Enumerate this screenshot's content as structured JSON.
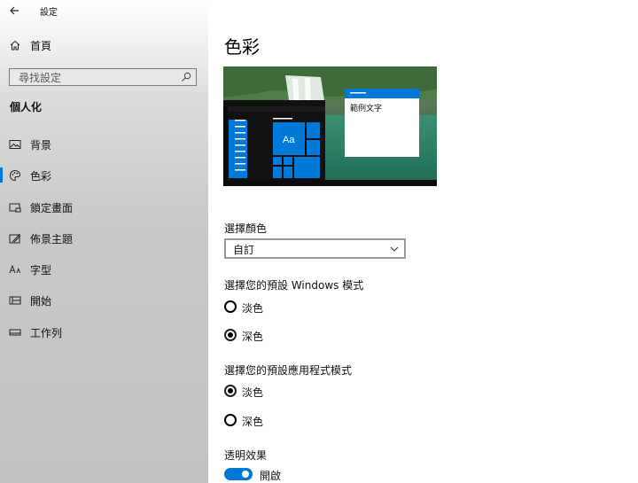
{
  "titlebar": {
    "app_title": "設定"
  },
  "sidebar": {
    "home_label": "首頁",
    "search_placeholder": "尋找設定",
    "section_title": "個人化",
    "items": [
      {
        "label": "背景",
        "icon": "image-icon"
      },
      {
        "label": "色彩",
        "icon": "palette-icon",
        "selected": true
      },
      {
        "label": "鎖定畫面",
        "icon": "lock-screen-icon"
      },
      {
        "label": "佈景主題",
        "icon": "theme-icon"
      },
      {
        "label": "字型",
        "icon": "font-icon"
      },
      {
        "label": "開始",
        "icon": "start-icon"
      },
      {
        "label": "工作列",
        "icon": "taskbar-icon"
      }
    ]
  },
  "main": {
    "title": "色彩",
    "preview": {
      "sample_text": "範例文字",
      "tile_text": "Aa"
    },
    "choose_color": {
      "label": "選擇顏色",
      "selected": "自訂"
    },
    "windows_mode": {
      "label": "選擇您的預設 Windows 模式",
      "options": [
        {
          "label": "淡色",
          "checked": false
        },
        {
          "label": "深色",
          "checked": true
        }
      ]
    },
    "app_mode": {
      "label": "選擇您的預設應用程式模式",
      "options": [
        {
          "label": "淡色",
          "checked": true
        },
        {
          "label": "深色",
          "checked": false
        }
      ]
    },
    "transparency": {
      "label": "透明效果",
      "state": "開啟",
      "on": true
    }
  },
  "colors": {
    "accent": "#0078d7"
  }
}
